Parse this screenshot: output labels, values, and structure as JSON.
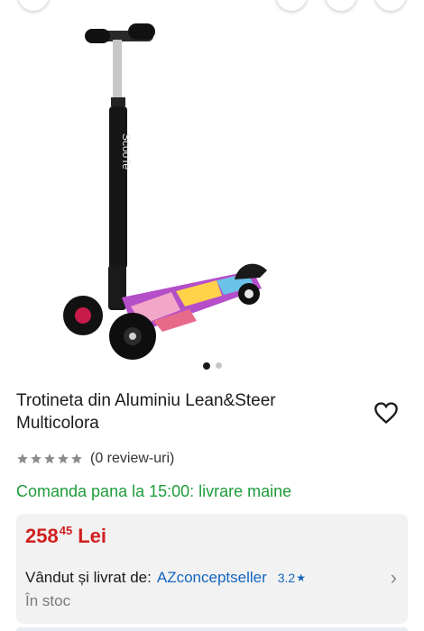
{
  "product": {
    "title": "Trotineta din Aluminiu Lean&Steer Multicolora",
    "image_dots": {
      "count": 2,
      "active": 0
    },
    "rating": {
      "stars": 0,
      "max": 5,
      "reviews_text": "(0 review-uri)"
    },
    "delivery_text": "Comanda pana la 15:00: livrare maine"
  },
  "offer": {
    "price_int": "258",
    "price_dec": "45",
    "currency": "Lei",
    "seller_label": "Vândut și livrat de:",
    "seller_name": "AZconceptseller",
    "seller_rating": "3.2",
    "stock": "În stoc"
  },
  "colors": {
    "price": "#d11f1f",
    "delivery": "#1e9c3a",
    "link": "#1565c0",
    "card": "#f2f2f2"
  },
  "icons": [
    "favorite-heart-icon",
    "star-icon",
    "chevron-right-icon"
  ]
}
